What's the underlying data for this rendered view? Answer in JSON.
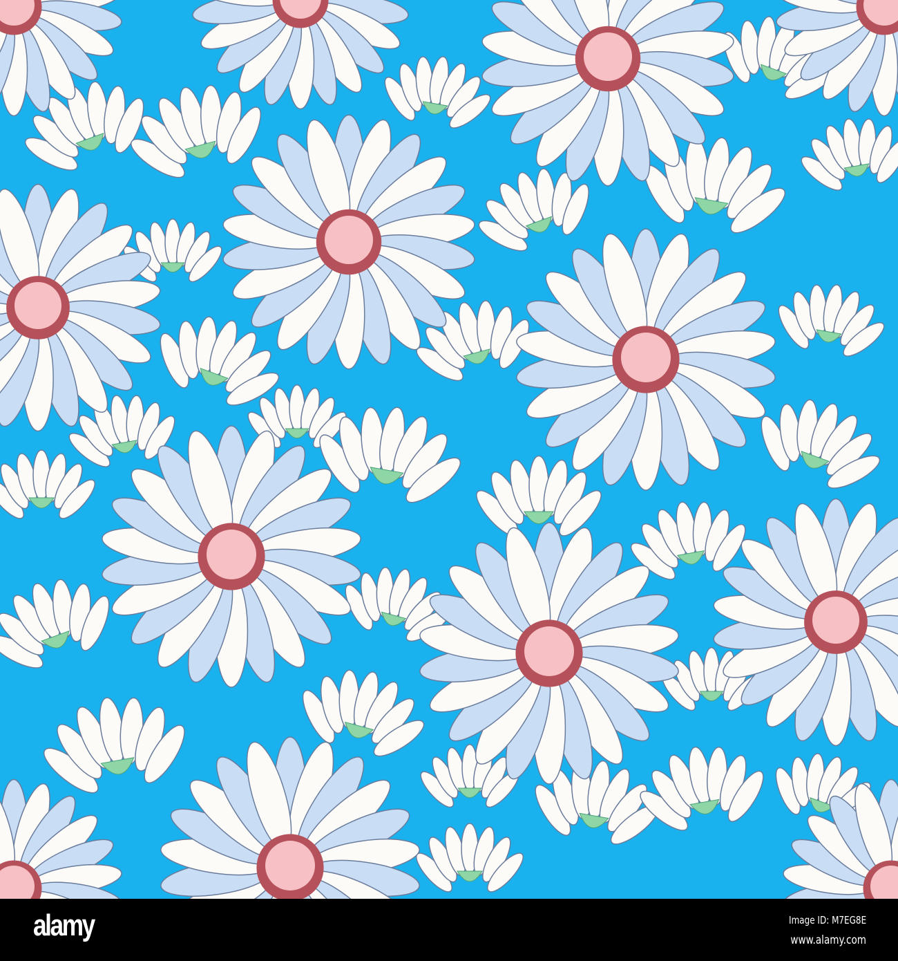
{
  "watermark": {
    "logo": "alamy",
    "image_id": "Image ID: M7EG8E",
    "website": "www.alamy.com"
  },
  "colors": {
    "background": "#1ab2ee",
    "petal": "#fdfbf8",
    "petal_shade": "#c9def5",
    "outline": "#6a7c9c",
    "center": "#f7c0c4",
    "center_dark": "#b5515a",
    "sepal": "#8fd6a6"
  }
}
